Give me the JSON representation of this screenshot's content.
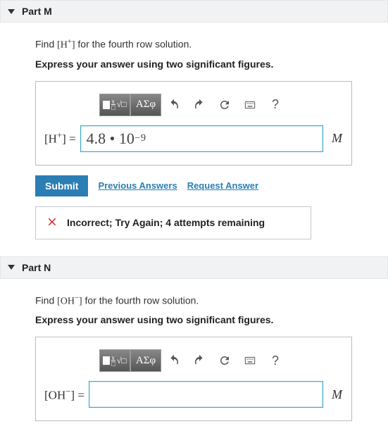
{
  "partM": {
    "title": "Part M",
    "prompt_prefix": "Find ",
    "prompt_symbol_open": "[H",
    "prompt_symbol_sup": "+",
    "prompt_symbol_close": "]",
    "prompt_suffix": " for the fourth row solution.",
    "instruction": "Express your answer using two significant figures.",
    "toolbar": {
      "greek": "ΑΣφ",
      "help": "?"
    },
    "lhs_open": "[H",
    "lhs_sup": "+",
    "lhs_close": "] = ",
    "value_mantissa": "4.8 • 10",
    "value_exponent": "−9",
    "unit": "M",
    "submit": "Submit",
    "prev": "Previous Answers",
    "req": "Request Answer",
    "feedback": "Incorrect; Try Again; 4 attempts remaining"
  },
  "partN": {
    "title": "Part N",
    "prompt_prefix": "Find ",
    "prompt_symbol_open": "[OH",
    "prompt_symbol_sup": "−",
    "prompt_symbol_close": "]",
    "prompt_suffix": " for the fourth row solution.",
    "instruction": "Express your answer using two significant figures.",
    "toolbar": {
      "greek": "ΑΣφ",
      "help": "?"
    },
    "lhs_open": "[OH",
    "lhs_sup": "−",
    "lhs_close": "] = ",
    "value_mantissa": "",
    "value_exponent": "",
    "unit": "M"
  }
}
